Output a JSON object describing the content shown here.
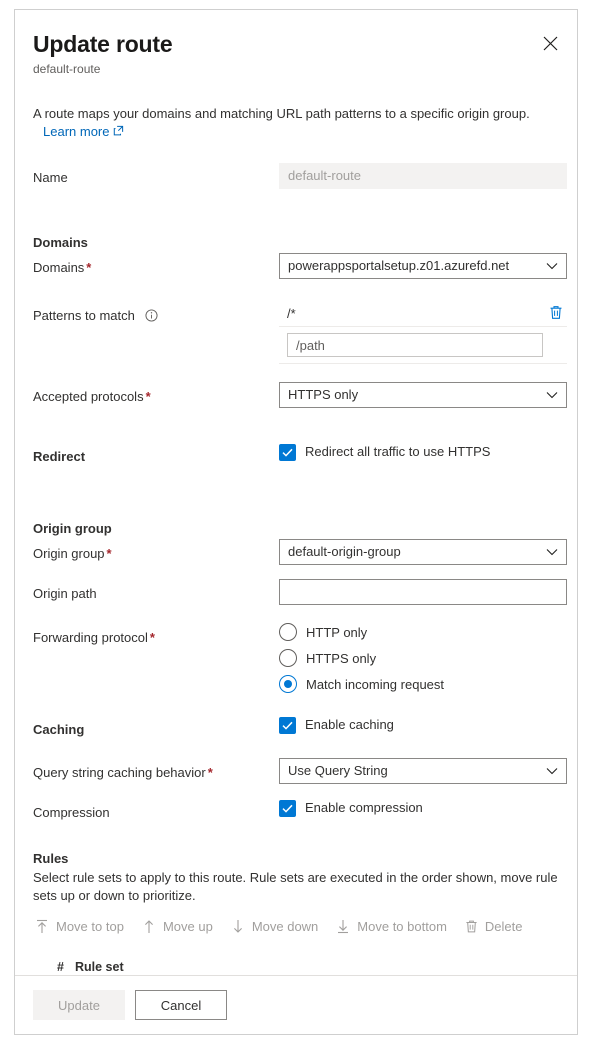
{
  "dialog": {
    "title": "Update route",
    "subtitle": "default-route",
    "close_icon": "close-icon",
    "description": "A route maps your domains and matching URL path patterns to a specific origin group.",
    "learn_more": "Learn more",
    "learn_more_icon": "external-link-icon"
  },
  "fields": {
    "name": {
      "label": "Name",
      "value": "default-route",
      "readonly": true
    },
    "domains_section": "Domains",
    "domains": {
      "label": "Domains",
      "required": true,
      "value": "powerappsportalsetup.z01.azurefd.net",
      "chevron_icon": "chevron-down-icon"
    },
    "patterns": {
      "label": "Patterns to match",
      "info_icon": "info-icon",
      "items": [
        {
          "value": "/*",
          "delete_icon": "trash-icon"
        }
      ],
      "new_placeholder": "/path",
      "new_value": ""
    },
    "accepted_protocols": {
      "label": "Accepted protocols",
      "required": true,
      "value": "HTTPS only",
      "chevron_icon": "chevron-down-icon"
    },
    "redirect": {
      "label": "Redirect",
      "checkbox_label": "Redirect all traffic to use HTTPS",
      "checked": true
    },
    "origin_group_section": "Origin group",
    "origin_group": {
      "label": "Origin group",
      "required": true,
      "value": "default-origin-group",
      "chevron_icon": "chevron-down-icon"
    },
    "origin_path": {
      "label": "Origin path",
      "value": ""
    },
    "forwarding_protocol": {
      "label": "Forwarding protocol",
      "required": true,
      "options": [
        {
          "label": "HTTP only",
          "selected": false
        },
        {
          "label": "HTTPS only",
          "selected": false
        },
        {
          "label": "Match incoming request",
          "selected": true
        }
      ]
    },
    "caching": {
      "label": "Caching",
      "checkbox_label": "Enable caching",
      "checked": true
    },
    "query_string_caching": {
      "label": "Query string caching behavior",
      "required": true,
      "value": "Use Query String",
      "chevron_icon": "chevron-down-icon"
    },
    "compression": {
      "label": "Compression",
      "checkbox_label": "Enable compression",
      "checked": true
    }
  },
  "rules": {
    "title": "Rules",
    "description": "Select rule sets to apply to this route. Rule sets are executed in the order shown, move rule sets up or down to prioritize.",
    "toolbar": [
      {
        "label": "Move to top",
        "icon": "arrow-up-to-line-icon",
        "disabled": true
      },
      {
        "label": "Move up",
        "icon": "arrow-up-icon",
        "disabled": true
      },
      {
        "label": "Move down",
        "icon": "arrow-down-icon",
        "disabled": true
      },
      {
        "label": "Move to bottom",
        "icon": "arrow-down-to-line-icon",
        "disabled": true
      },
      {
        "label": "Delete",
        "icon": "trash-icon",
        "disabled": true
      }
    ],
    "columns": [
      "#",
      "Rule set"
    ],
    "rows": []
  },
  "footer": {
    "update_label": "Update",
    "update_disabled": true,
    "cancel_label": "Cancel"
  },
  "colors": {
    "accent": "#0078d4",
    "link": "#0067b8",
    "required": "#a4262c",
    "disabled_text": "#a19f9d",
    "border": "#8a8886"
  }
}
